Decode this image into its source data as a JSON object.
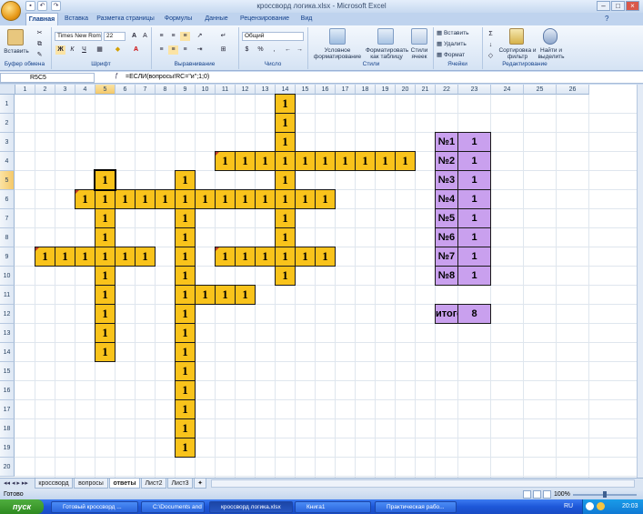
{
  "window": {
    "title": "кроссворд логика.xlsx - Microsoft Excel",
    "qat_icons": [
      "save-icon",
      "undo-icon",
      "redo-icon"
    ]
  },
  "ribbon": {
    "tabs": [
      "Главная",
      "Вставка",
      "Разметка страницы",
      "Формулы",
      "Данные",
      "Рецензирование",
      "Вид"
    ],
    "active_tab": "Главная",
    "clipboard": {
      "paste_label": "Вставить",
      "group_label": "Буфер обмена"
    },
    "font": {
      "family": "Times New Rom",
      "size": "22",
      "group_label": "Шрифт",
      "bold": "Ж",
      "italic": "К",
      "underline": "Ч"
    },
    "alignment": {
      "group_label": "Выравнивание"
    },
    "number": {
      "format": "Общий",
      "group_label": "Число"
    },
    "styles": {
      "conditional": "Условное форматирование",
      "as_table": "Форматировать как таблицу",
      "cell_styles": "Стили ячеек",
      "group_label": "Стили"
    },
    "cells": {
      "insert": "Вставить",
      "delete": "Удалить",
      "format": "Формат",
      "group_label": "Ячейки"
    },
    "editing": {
      "sort": "Сортировка и фильтр",
      "find": "Найти и выделить",
      "group_label": "Редактирование"
    }
  },
  "formula_bar": {
    "name_box": "R5C5",
    "formula": "=ЕСЛИ(вопросы!RC=\"и\";1;0)"
  },
  "grid": {
    "columns": [
      "1",
      "2",
      "3",
      "4",
      "5",
      "6",
      "7",
      "8",
      "9",
      "10",
      "11",
      "12",
      "13",
      "14",
      "15",
      "16",
      "17",
      "18",
      "19",
      "20",
      "21",
      "22",
      "23",
      "24",
      "25",
      "26"
    ],
    "rows": [
      "1",
      "2",
      "3",
      "4",
      "5",
      "6",
      "7",
      "8",
      "9",
      "10",
      "11",
      "12",
      "13",
      "14",
      "15",
      "16",
      "17",
      "18",
      "19",
      "20"
    ],
    "selected_col": "5",
    "selected_row": "5",
    "cell_value": "1",
    "crossword_cells": [
      [
        1,
        14
      ],
      [
        2,
        14
      ],
      [
        3,
        14
      ],
      [
        4,
        11
      ],
      [
        4,
        12
      ],
      [
        4,
        13
      ],
      [
        4,
        14
      ],
      [
        4,
        15
      ],
      [
        4,
        16
      ],
      [
        4,
        17
      ],
      [
        4,
        18
      ],
      [
        4,
        19
      ],
      [
        4,
        20
      ],
      [
        5,
        5
      ],
      [
        5,
        9
      ],
      [
        5,
        14
      ],
      [
        6,
        4
      ],
      [
        6,
        5
      ],
      [
        6,
        6
      ],
      [
        6,
        7
      ],
      [
        6,
        8
      ],
      [
        6,
        9
      ],
      [
        6,
        10
      ],
      [
        6,
        11
      ],
      [
        6,
        12
      ],
      [
        6,
        13
      ],
      [
        6,
        14
      ],
      [
        6,
        15
      ],
      [
        6,
        16
      ],
      [
        7,
        5
      ],
      [
        7,
        9
      ],
      [
        7,
        14
      ],
      [
        8,
        5
      ],
      [
        8,
        9
      ],
      [
        8,
        14
      ],
      [
        9,
        2
      ],
      [
        9,
        3
      ],
      [
        9,
        4
      ],
      [
        9,
        5
      ],
      [
        9,
        6
      ],
      [
        9,
        7
      ],
      [
        9,
        9
      ],
      [
        9,
        11
      ],
      [
        9,
        12
      ],
      [
        9,
        13
      ],
      [
        9,
        14
      ],
      [
        9,
        15
      ],
      [
        9,
        16
      ],
      [
        10,
        5
      ],
      [
        10,
        9
      ],
      [
        10,
        14
      ],
      [
        11,
        5
      ],
      [
        11,
        9
      ],
      [
        11,
        10
      ],
      [
        11,
        11
      ],
      [
        11,
        12
      ],
      [
        12,
        5
      ],
      [
        12,
        9
      ],
      [
        13,
        5
      ],
      [
        13,
        9
      ],
      [
        14,
        5
      ],
      [
        14,
        9
      ],
      [
        15,
        9
      ],
      [
        16,
        9
      ],
      [
        17,
        9
      ],
      [
        18,
        9
      ],
      [
        19,
        9
      ]
    ],
    "comment_cells": [
      [
        4,
        11
      ],
      [
        6,
        4
      ],
      [
        9,
        2
      ],
      [
        9,
        11
      ]
    ],
    "results": [
      {
        "label": "№1",
        "value": "1"
      },
      {
        "label": "№2",
        "value": "1"
      },
      {
        "label": "№3",
        "value": "1"
      },
      {
        "label": "№4",
        "value": "1"
      },
      {
        "label": "№5",
        "value": "1"
      },
      {
        "label": "№6",
        "value": "1"
      },
      {
        "label": "№7",
        "value": "1"
      },
      {
        "label": "№8",
        "value": "1"
      }
    ],
    "total": {
      "label": "итого",
      "value": "8"
    }
  },
  "sheets": [
    "кроссворд",
    "вопросы",
    "ответы",
    "Лист2",
    "Лист3"
  ],
  "active_sheet": "ответы",
  "status": {
    "ready": "Готово",
    "zoom": "100%"
  },
  "taskbar": {
    "start": "пуск",
    "items": [
      "Готовый кроссворд ...",
      "C:\\Documents and Se...",
      "кроссворд логика.xlsx",
      "Книга1",
      "Практическая рабо..."
    ],
    "active_item": "кроссворд логика.xlsx",
    "lang": "RU",
    "time": "20:03"
  },
  "colors": {
    "crossword_fill": "#f9c31b",
    "result_fill": "#c9a0ee",
    "taskbar": "#1d57d8"
  }
}
